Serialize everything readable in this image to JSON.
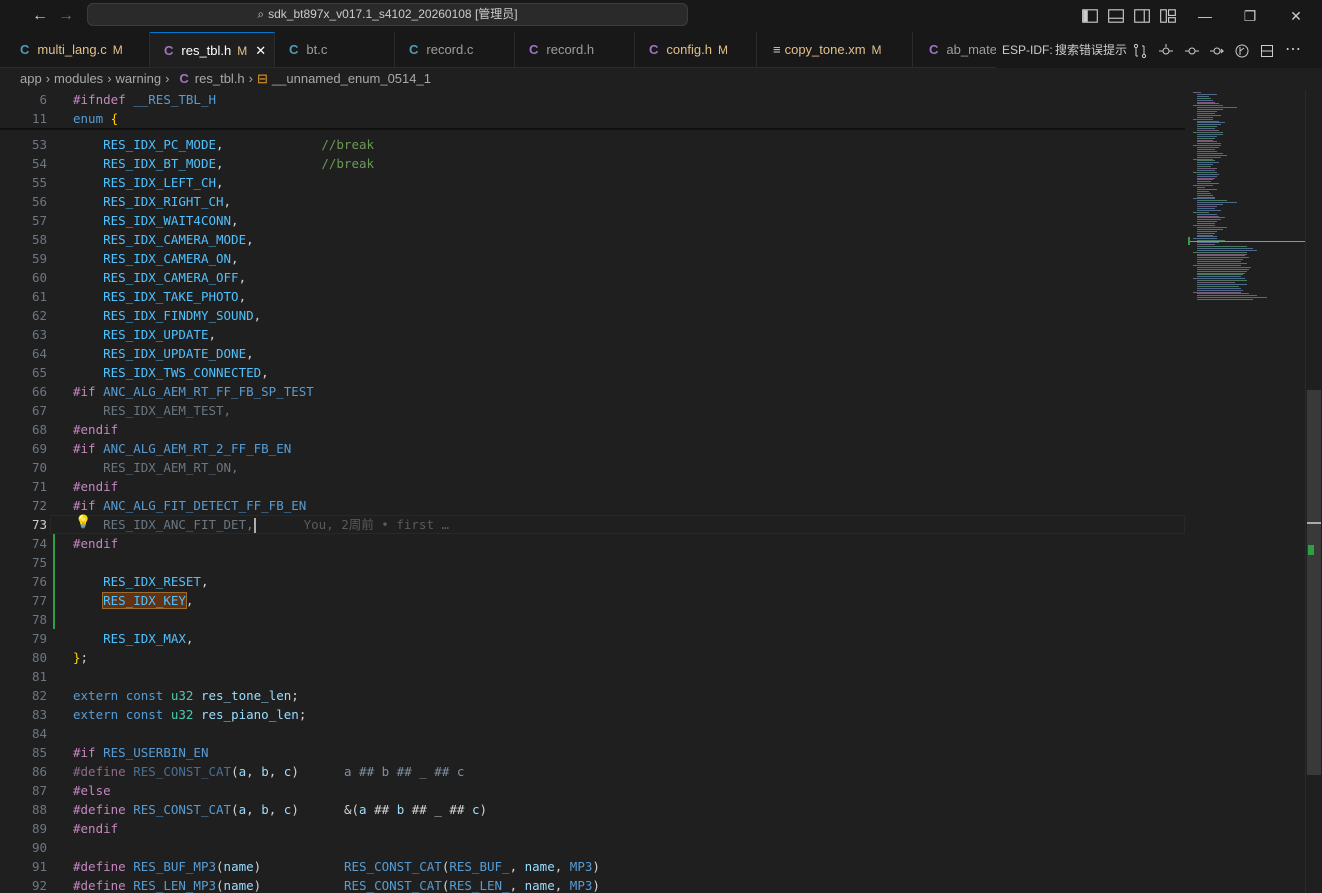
{
  "titlebar": {
    "search_text": "sdk_bt897x_v017.1_s4102_20260108 [管理员]",
    "nav_back": "←",
    "nav_forward": "→",
    "minimize": "—",
    "restore": "❐",
    "close": "✕"
  },
  "tabs": [
    {
      "icon": "C",
      "label": "multi_lang.c",
      "status": "M",
      "active": false,
      "modified": true
    },
    {
      "icon": "C",
      "label": "res_tbl.h",
      "status": "M",
      "active": true,
      "modified": true
    },
    {
      "icon": "C",
      "label": "bt.c",
      "status": "",
      "active": false,
      "modified": false
    },
    {
      "icon": "C",
      "label": "record.c",
      "status": "",
      "active": false,
      "modified": false
    },
    {
      "icon": "C",
      "label": "record.h",
      "status": "",
      "active": false,
      "modified": false
    },
    {
      "icon": "C",
      "label": "config.h",
      "status": "M",
      "active": false,
      "modified": true
    },
    {
      "icon": "≡",
      "label": "copy_tone.xm",
      "status": "M",
      "active": false,
      "modified": true
    },
    {
      "icon": "C",
      "label": "ab_mate_",
      "status": "",
      "active": false,
      "modified": false
    }
  ],
  "tab_actions": {
    "esp_idf_label": "ESP-IDF:",
    "search_hint": "搜索错误提示"
  },
  "breadcrumb": {
    "items": [
      "app",
      "modules",
      "warning"
    ],
    "file_icon": "C",
    "file": "res_tbl.h",
    "symbol": "__unnamed_enum_0514_1"
  },
  "editor": {
    "sticky": [
      {
        "ln": "6",
        "tokens": [
          [
            "kw-pp",
            "#ifndef"
          ],
          [
            "punct",
            " "
          ],
          [
            "macro",
            "__RES_TBL_H"
          ]
        ]
      },
      {
        "ln": "11",
        "tokens": [
          [
            "kw",
            "enum"
          ],
          [
            "punct",
            " "
          ],
          [
            "brace",
            "{"
          ]
        ]
      }
    ],
    "lines": [
      {
        "ln": "53",
        "tokens": [
          [
            "punct",
            "    "
          ],
          [
            "enumc",
            "RES_IDX_PC_MODE"
          ],
          [
            "punct",
            ",             "
          ],
          [
            "comment",
            "//break"
          ]
        ]
      },
      {
        "ln": "54",
        "tokens": [
          [
            "punct",
            "    "
          ],
          [
            "enumc",
            "RES_IDX_BT_MODE"
          ],
          [
            "punct",
            ",             "
          ],
          [
            "comment",
            "//break"
          ]
        ]
      },
      {
        "ln": "55",
        "tokens": [
          [
            "punct",
            "    "
          ],
          [
            "enumc",
            "RES_IDX_LEFT_CH"
          ],
          [
            "punct",
            ","
          ]
        ]
      },
      {
        "ln": "56",
        "tokens": [
          [
            "punct",
            "    "
          ],
          [
            "enumc",
            "RES_IDX_RIGHT_CH"
          ],
          [
            "punct",
            ","
          ]
        ]
      },
      {
        "ln": "57",
        "tokens": [
          [
            "punct",
            "    "
          ],
          [
            "enumc",
            "RES_IDX_WAIT4CONN"
          ],
          [
            "punct",
            ","
          ]
        ]
      },
      {
        "ln": "58",
        "tokens": [
          [
            "punct",
            "    "
          ],
          [
            "enumc",
            "RES_IDX_CAMERA_MODE"
          ],
          [
            "punct",
            ","
          ]
        ]
      },
      {
        "ln": "59",
        "tokens": [
          [
            "punct",
            "    "
          ],
          [
            "enumc",
            "RES_IDX_CAMERA_ON"
          ],
          [
            "punct",
            ","
          ]
        ]
      },
      {
        "ln": "60",
        "tokens": [
          [
            "punct",
            "    "
          ],
          [
            "enumc",
            "RES_IDX_CAMERA_OFF"
          ],
          [
            "punct",
            ","
          ]
        ]
      },
      {
        "ln": "61",
        "tokens": [
          [
            "punct",
            "    "
          ],
          [
            "enumc",
            "RES_IDX_TAKE_PHOTO"
          ],
          [
            "punct",
            ","
          ]
        ]
      },
      {
        "ln": "62",
        "tokens": [
          [
            "punct",
            "    "
          ],
          [
            "enumc",
            "RES_IDX_FINDMY_SOUND"
          ],
          [
            "punct",
            ","
          ]
        ]
      },
      {
        "ln": "63",
        "tokens": [
          [
            "punct",
            "    "
          ],
          [
            "enumc",
            "RES_IDX_UPDATE"
          ],
          [
            "punct",
            ","
          ]
        ]
      },
      {
        "ln": "64",
        "tokens": [
          [
            "punct",
            "    "
          ],
          [
            "enumc",
            "RES_IDX_UPDATE_DONE"
          ],
          [
            "punct",
            ","
          ]
        ]
      },
      {
        "ln": "65",
        "tokens": [
          [
            "punct",
            "    "
          ],
          [
            "enumc",
            "RES_IDX_TWS_CONNECTED"
          ],
          [
            "punct",
            ","
          ]
        ]
      },
      {
        "ln": "66",
        "tokens": [
          [
            "kw-pp",
            "#if"
          ],
          [
            "punct",
            " "
          ],
          [
            "macro",
            "ANC_ALG_AEM_RT_FF_FB_SP_TEST"
          ]
        ]
      },
      {
        "ln": "67",
        "tokens": [
          [
            "punct",
            "    "
          ],
          [
            "dim",
            "RES_IDX_AEM_TEST,"
          ]
        ]
      },
      {
        "ln": "68",
        "tokens": [
          [
            "kw-pp",
            "#endif"
          ]
        ]
      },
      {
        "ln": "69",
        "tokens": [
          [
            "kw-pp",
            "#if"
          ],
          [
            "punct",
            " "
          ],
          [
            "macro",
            "ANC_ALG_AEM_RT_2_FF_FB_EN"
          ]
        ]
      },
      {
        "ln": "70",
        "tokens": [
          [
            "punct",
            "    "
          ],
          [
            "dim",
            "RES_IDX_AEM_RT_ON,"
          ]
        ]
      },
      {
        "ln": "71",
        "tokens": [
          [
            "kw-pp",
            "#endif"
          ]
        ]
      },
      {
        "ln": "72",
        "tokens": [
          [
            "kw-pp",
            "#if"
          ],
          [
            "punct",
            " "
          ],
          [
            "macro",
            "ANC_ALG_FIT_DETECT_FF_FB_EN"
          ]
        ]
      },
      {
        "ln": "73",
        "current": true,
        "tokens": [
          [
            "punct",
            "    "
          ],
          [
            "dim",
            "RES_IDX_ANC_FIT_DET,"
          ]
        ],
        "blame": "You, 2周前 • first …"
      },
      {
        "ln": "74",
        "tokens": [
          [
            "kw-pp",
            "#endif"
          ]
        ]
      },
      {
        "ln": "75",
        "tokens": []
      },
      {
        "ln": "76",
        "tokens": [
          [
            "punct",
            "    "
          ],
          [
            "enumc",
            "RES_IDX_RESET"
          ],
          [
            "punct",
            ","
          ]
        ]
      },
      {
        "ln": "77",
        "tokens": [
          [
            "punct",
            "    "
          ],
          [
            "enumc hl-key",
            "RES_IDX_KEY"
          ],
          [
            "punct",
            ","
          ]
        ]
      },
      {
        "ln": "78",
        "tokens": []
      },
      {
        "ln": "79",
        "tokens": [
          [
            "punct",
            "    "
          ],
          [
            "enumc",
            "RES_IDX_MAX"
          ],
          [
            "punct",
            ","
          ]
        ]
      },
      {
        "ln": "80",
        "tokens": [
          [
            "brace",
            "}"
          ],
          [
            "punct",
            ";"
          ]
        ]
      },
      {
        "ln": "81",
        "tokens": []
      },
      {
        "ln": "82",
        "tokens": [
          [
            "kw",
            "extern"
          ],
          [
            "punct",
            " "
          ],
          [
            "kw",
            "const"
          ],
          [
            "punct",
            " "
          ],
          [
            "type",
            "u32"
          ],
          [
            "punct",
            " "
          ],
          [
            "ident",
            "res_tone_len"
          ],
          [
            "punct",
            ";"
          ]
        ]
      },
      {
        "ln": "83",
        "tokens": [
          [
            "kw",
            "extern"
          ],
          [
            "punct",
            " "
          ],
          [
            "kw",
            "const"
          ],
          [
            "punct",
            " "
          ],
          [
            "type",
            "u32"
          ],
          [
            "punct",
            " "
          ],
          [
            "ident",
            "res_piano_len"
          ],
          [
            "punct",
            ";"
          ]
        ]
      },
      {
        "ln": "84",
        "tokens": []
      },
      {
        "ln": "85",
        "tokens": [
          [
            "kw-pp",
            "#if"
          ],
          [
            "punct",
            " "
          ],
          [
            "macro",
            "RES_USERBIN_EN"
          ]
        ]
      },
      {
        "ln": "86",
        "tokens": [
          [
            "kw-pp-dim",
            "#define"
          ],
          [
            "punct",
            " "
          ],
          [
            "macro-dim",
            "RES_CONST_CAT"
          ],
          [
            "punct",
            "("
          ],
          [
            "ident",
            "a"
          ],
          [
            "punct",
            ", "
          ],
          [
            "ident",
            "b"
          ],
          [
            "punct",
            ", "
          ],
          [
            "ident",
            "c"
          ],
          [
            "punct",
            ")      "
          ],
          [
            "str-dim",
            "a ## b ## _ ## c"
          ]
        ]
      },
      {
        "ln": "87",
        "tokens": [
          [
            "kw-pp",
            "#else"
          ]
        ]
      },
      {
        "ln": "88",
        "tokens": [
          [
            "kw-pp",
            "#define"
          ],
          [
            "punct",
            " "
          ],
          [
            "macro",
            "RES_CONST_CAT"
          ],
          [
            "punct",
            "("
          ],
          [
            "ident",
            "a"
          ],
          [
            "punct",
            ", "
          ],
          [
            "ident",
            "b"
          ],
          [
            "punct",
            ", "
          ],
          [
            "ident",
            "c"
          ],
          [
            "punct",
            ")      &("
          ],
          [
            "ident",
            "a"
          ],
          [
            "punct",
            " ## "
          ],
          [
            "ident",
            "b"
          ],
          [
            "punct",
            " ## _ ## "
          ],
          [
            "ident",
            "c"
          ],
          [
            "punct",
            ")"
          ]
        ]
      },
      {
        "ln": "89",
        "tokens": [
          [
            "kw-pp",
            "#endif"
          ]
        ]
      },
      {
        "ln": "90",
        "tokens": []
      },
      {
        "ln": "91",
        "tokens": [
          [
            "kw-pp",
            "#define"
          ],
          [
            "punct",
            " "
          ],
          [
            "macro",
            "RES_BUF_MP3"
          ],
          [
            "punct",
            "("
          ],
          [
            "ident",
            "name"
          ],
          [
            "punct",
            ")           "
          ],
          [
            "macro",
            "RES_CONST_CAT"
          ],
          [
            "punct",
            "("
          ],
          [
            "macro",
            "RES_BUF_"
          ],
          [
            "punct",
            ", "
          ],
          [
            "ident",
            "name"
          ],
          [
            "punct",
            ", "
          ],
          [
            "macro",
            "MP3"
          ],
          [
            "punct",
            ")"
          ]
        ]
      },
      {
        "ln": "92",
        "tokens": [
          [
            "kw-pp",
            "#define"
          ],
          [
            "punct",
            " "
          ],
          [
            "macro",
            "RES_LEN_MP3"
          ],
          [
            "punct",
            "("
          ],
          [
            "ident",
            "name"
          ],
          [
            "punct",
            ")           "
          ],
          [
            "macro",
            "RES_CONST_CAT"
          ],
          [
            "punct",
            "("
          ],
          [
            "macro",
            "RES_LEN_"
          ],
          [
            "punct",
            ", "
          ],
          [
            "ident",
            "name"
          ],
          [
            "punct",
            ", "
          ],
          [
            "macro",
            "MP3"
          ],
          [
            "punct",
            ")"
          ]
        ]
      }
    ]
  },
  "colors": {
    "accent": "#0078d4",
    "modified": "#e2c08d",
    "git_added": "#2ea043"
  }
}
